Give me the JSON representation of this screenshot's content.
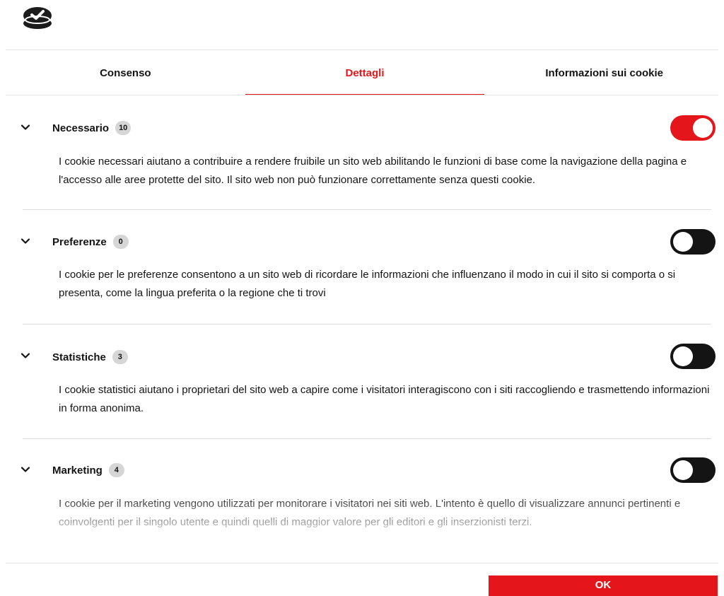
{
  "logo": {
    "icon": "cookie-check-logo-icon"
  },
  "tabs": [
    {
      "label": "Consenso",
      "active": false
    },
    {
      "label": "Dettagli",
      "active": true
    },
    {
      "label": "Informazioni sui cookie",
      "active": false
    }
  ],
  "sections": [
    {
      "title": "Necessario",
      "count": "10",
      "enabled": true,
      "description": "I cookie necessari aiutano a contribuire a rendere fruibile un sito web abilitando le funzioni di base come la navigazione della pagina e l'accesso alle aree protette del sito. Il sito web non può funzionare correttamente senza questi cookie."
    },
    {
      "title": "Preferenze",
      "count": "0",
      "enabled": false,
      "description": "I cookie per le preferenze consentono a un sito web di ricordare le informazioni che influenzano il modo in cui il sito si comporta o si presenta, come la lingua preferita o la regione che ti trovi"
    },
    {
      "title": "Statistiche",
      "count": "3",
      "enabled": false,
      "description": "I cookie statistici aiutano i proprietari del sito web a capire come i visitatori interagiscono con i siti raccogliendo e trasmettendo informazioni in forma anonima."
    },
    {
      "title": "Marketing",
      "count": "4",
      "enabled": false,
      "description": "I cookie per il marketing vengono utilizzati per monitorare i visitatori nei siti web. L'intento è quello di visualizzare annunci pertinenti e coinvolgenti per il singolo utente e quindi quelli di maggior valore per gli editori e gli inserzionisti terzi."
    }
  ],
  "ok_label": "OK",
  "colors": {
    "accent": "#e4161b",
    "toggle_off": "#141414",
    "badge": "#d6d6d6"
  }
}
